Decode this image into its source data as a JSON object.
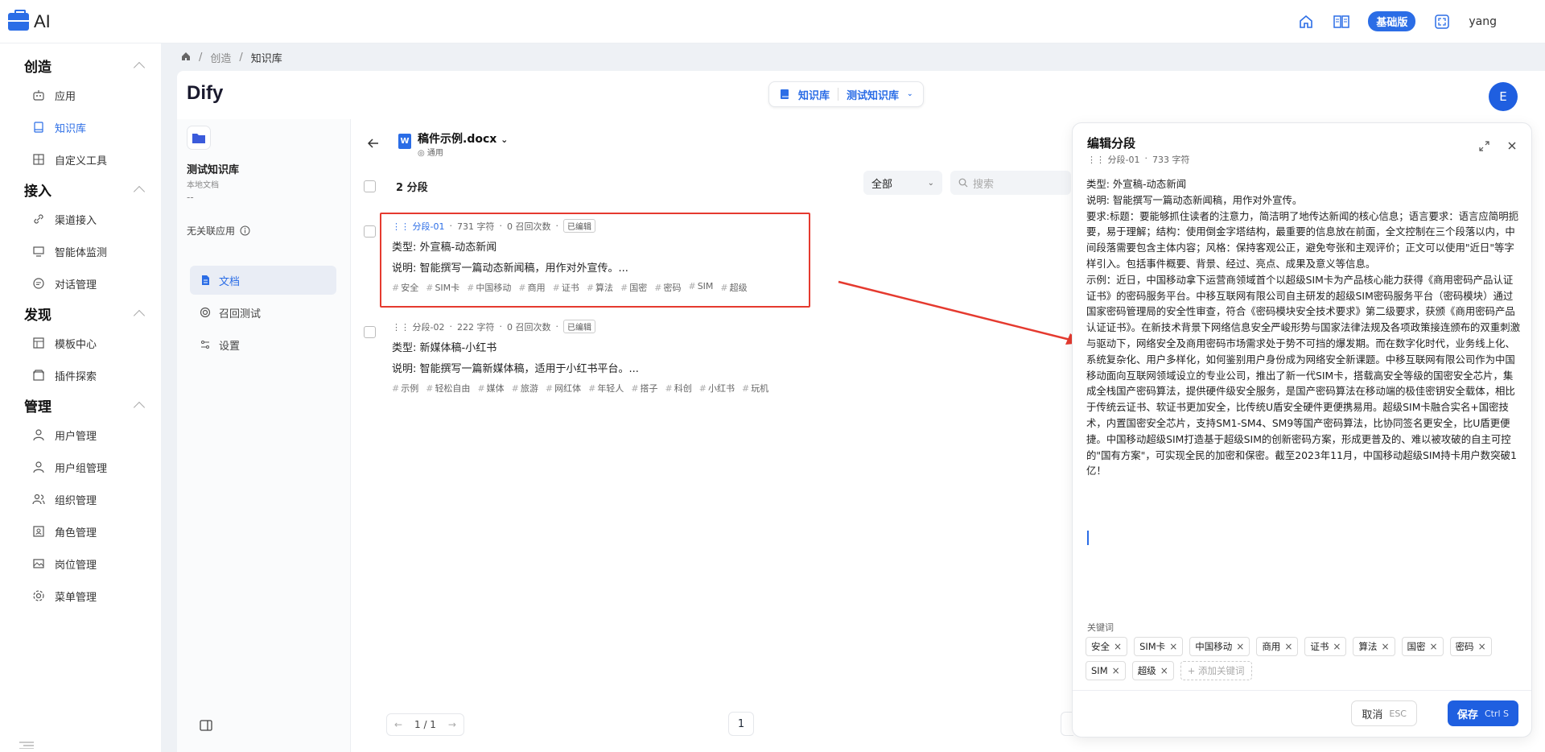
{
  "app": {
    "logo_text": "AI",
    "plan_badge": "基础版",
    "username": "yang"
  },
  "sidebar": {
    "groups": [
      {
        "title": "创造",
        "items": [
          "应用",
          "知识库",
          "自定义工具"
        ]
      },
      {
        "title": "接入",
        "items": [
          "渠道接入",
          "智能体监测",
          "对话管理"
        ]
      },
      {
        "title": "发现",
        "items": [
          "模板中心",
          "插件探索"
        ]
      },
      {
        "title": "管理",
        "items": [
          "用户管理",
          "用户组管理",
          "组织管理",
          "角色管理",
          "岗位管理",
          "菜单管理"
        ]
      }
    ]
  },
  "breadcrumb": {
    "level1": "创造",
    "level2": "知识库"
  },
  "header": {
    "brand": "Dify",
    "tab_knowledge": "知识库",
    "tab_dataset": "测试知识库",
    "avatar": "E"
  },
  "dataset": {
    "name": "测试知识库",
    "type": "本地文档",
    "dash": "--",
    "assoc": "无关联应用",
    "menu": [
      "文档",
      "召回测试",
      "设置"
    ]
  },
  "document": {
    "title": "稿件示例.docx",
    "mode": "通用",
    "segment_count": "2 分段",
    "filter": "全部",
    "search_placeholder": "搜索",
    "segments": [
      {
        "id": "分段-01",
        "chars": "731 字符",
        "recalls": "0 召回次数",
        "status": "已编辑",
        "line1": "类型: 外宣稿-动态新闻",
        "line2": "说明: 智能撰写一篇动态新闻稿，用作对外宣传。...",
        "tags": [
          "安全",
          "SIM卡",
          "中国移动",
          "商用",
          "证书",
          "算法",
          "国密",
          "密码",
          "SIM",
          "超级"
        ]
      },
      {
        "id": "分段-02",
        "chars": "222 字符",
        "recalls": "0 召回次数",
        "status": "已编辑",
        "line1": "类型: 新媒体稿-小红书",
        "line2": "说明: 智能撰写一篇新媒体稿，适用于小红书平台。...",
        "tags": [
          "示例",
          "轻松自由",
          "媒体",
          "旅游",
          "网红体",
          "年轻人",
          "搭子",
          "科创",
          "小红书",
          "玩机"
        ]
      }
    ],
    "pager": "1 / 1",
    "page": "1"
  },
  "edit": {
    "title": "编辑分段",
    "seg_id": "分段-01",
    "chars": "733 字符",
    "content": "类型: 外宣稿-动态新闻\n说明: 智能撰写一篇动态新闻稿，用作对外宣传。\n要求:标题：要能够抓住读者的注意力，简洁明了地传达新闻的核心信息；语言要求：语言应简明扼要，易于理解；结构：使用倒金字塔结构，最重要的信息放在前面，全文控制在三个段落以内，中间段落需要包含主体内容；风格：保持客观公正，避免夸张和主观评价；正文可以使用\"近日\"等字样引入。包括事件概要、背景、经过、亮点、成果及意义等信息。\n示例：近日，中国移动拿下运营商领域首个以超级SIM卡为产品核心能力获得《商用密码产品认证证书》的密码服务平台。中移互联网有限公司自主研发的超级SIM密码服务平台（密码模块）通过国家密码管理局的安全性审查，符合《密码模块安全技术要求》第二级要求，获颁《商用密码产品认证证书》。在新技术背景下网络信息安全严峻形势与国家法律法规及各项政策接连颁布的双重刺激与驱动下，网络安全及商用密码市场需求处于势不可挡的爆发期。而在数字化时代，业务线上化、系统复杂化、用户多样化，如何鉴别用户身份成为网络安全新课题。中移互联网有限公司作为中国移动面向互联网领域设立的专业公司，推出了新一代SIM卡，搭载高安全等级的国密安全芯片，集成全栈国产密码算法，提供硬件级安全服务，是国产密码算法在移动端的极佳密钥安全载体，相比于传统云证书、软证书更加安全，比传统U盾安全硬件更便携易用。超级SIM卡融合实名+国密技术，内置国密安全芯片，支持SM1-SM4、SM9等国产密码算法，比协同签名更安全，比U盾更便捷。中国移动超级SIM打造基于超级SIM的创新密码方案，形成更普及的、难以被攻破的自主可控的\"国有方案\"，可实现全民的加密和保密。截至2023年11月，中国移动超级SIM持卡用户数突破1亿！",
    "keywords_label": "关键词",
    "keywords": [
      "安全",
      "SIM卡",
      "中国移动",
      "商用",
      "证书",
      "算法",
      "国密",
      "密码",
      "SIM",
      "超级"
    ],
    "add_keyword": "+ 添加关键词",
    "cancel": "取消",
    "cancel_key": "ESC",
    "save": "保存",
    "save_key": "Ctrl S"
  },
  "colors": {
    "accent": "#2b6de6",
    "highlight": "#e53a2f"
  }
}
